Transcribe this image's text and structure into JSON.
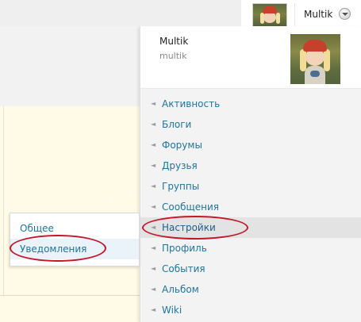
{
  "account": {
    "display_name": "Multik",
    "login": "multik"
  },
  "menu": {
    "items": [
      {
        "label": "Активность"
      },
      {
        "label": "Блоги"
      },
      {
        "label": "Форумы"
      },
      {
        "label": "Друзья"
      },
      {
        "label": "Группы"
      },
      {
        "label": "Сообщения"
      },
      {
        "label": "Настройки"
      },
      {
        "label": "Профиль"
      },
      {
        "label": "События"
      },
      {
        "label": "Альбом"
      },
      {
        "label": "Wiki"
      }
    ],
    "active_index": 6
  },
  "submenu": {
    "items": [
      {
        "label": "Общее"
      },
      {
        "label": "Уведомления"
      }
    ],
    "hover_index": 1
  },
  "icons": {
    "menu_arrow": "arrow-left-icon",
    "account_toggle": "chevron-down-icon"
  },
  "colors": {
    "link": "#21759b",
    "annotation": "#c4162a",
    "dropdown_bg": "#f3f3f3",
    "active_row": "#e3e3e3",
    "content_bg": "#fffbe6"
  }
}
